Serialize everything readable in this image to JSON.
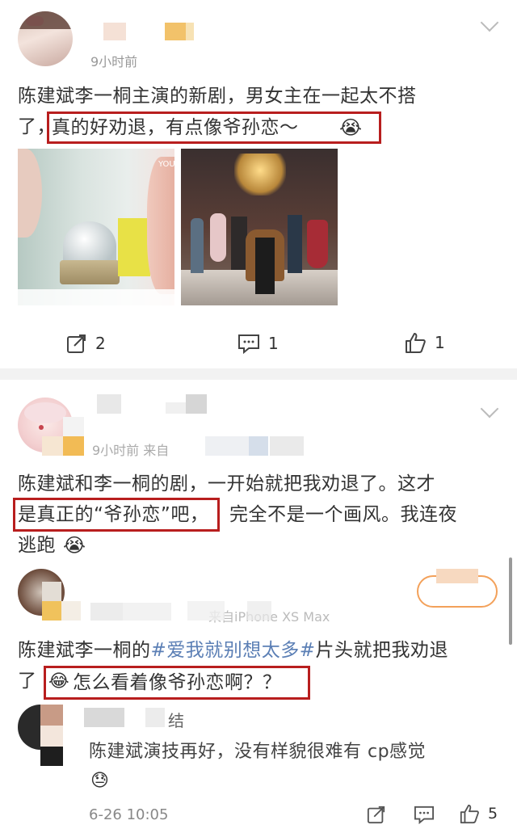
{
  "post1": {
    "time": "9小时前",
    "text_line1": "陈建斌李一桐主演的新剧，男女主在一起太不搭",
    "text_line2a": "了，",
    "text_highlight": "真的好劝退，有点像爷孙恋～",
    "emoji": "😭",
    "image_watermark": "YOU",
    "repost_count": "2",
    "comment_count": "1",
    "like_count": "1"
  },
  "post2": {
    "time": "9小时前 来自",
    "line1": "陈建斌和李一桐的剧，一开始就把我劝退了。这才",
    "line2_highlight": "是真正的“爷孙恋”吧，",
    "line2_rest": "完全不是一个画风。我连夜",
    "line3": "逃跑",
    "emoji": "😭"
  },
  "comment1": {
    "meta": "来自iPhone XS Max",
    "line1_a": "陈建斌李一桐的",
    "line1_tag": "#爱我就别想太多#",
    "line1_b": "片头就把我劝退",
    "line2_a": "了",
    "line2_highlight": "怎么看着像爷孙恋啊？？",
    "emoji": "😂"
  },
  "reply1": {
    "name_suffix": "结",
    "text_line1": "陈建斌演技再好，没有样貌很难有 cp感觉",
    "emoji": "😓",
    "time": "6-26 10:05",
    "like_count": "5"
  }
}
